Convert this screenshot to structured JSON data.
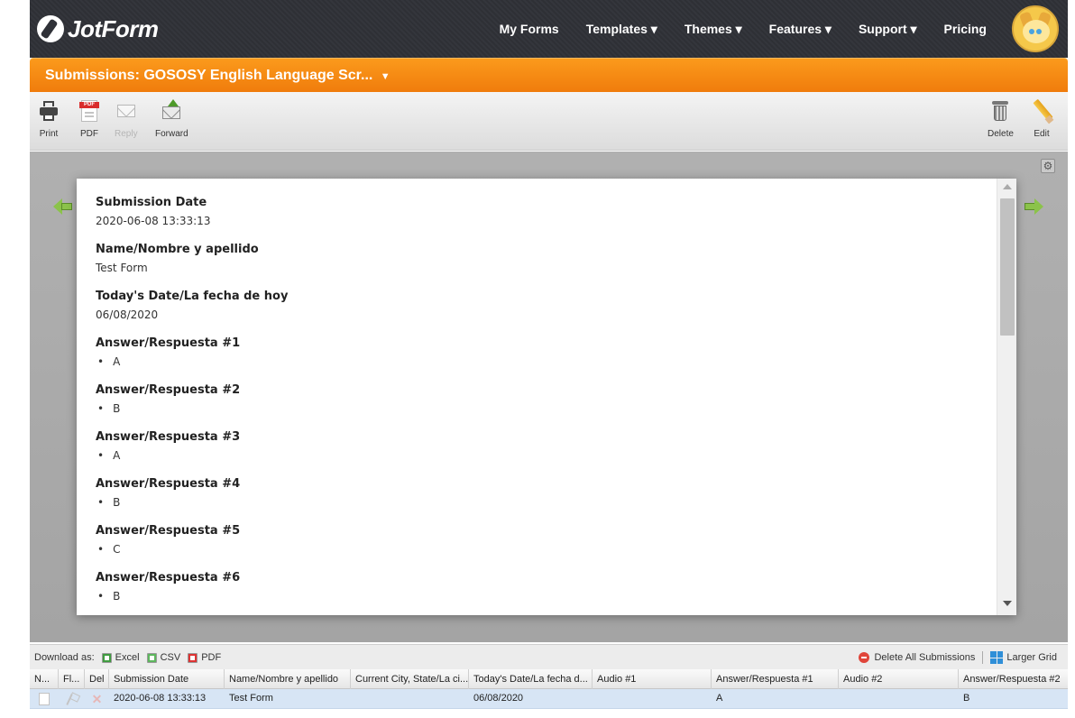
{
  "nav": {
    "logo": "JotForm",
    "items": [
      "My Forms",
      "Templates ▾",
      "Themes ▾",
      "Features ▾",
      "Support ▾",
      "Pricing"
    ]
  },
  "titlebar": {
    "title": "Submissions: GOSOSY English Language Scr...",
    "caret": "▼"
  },
  "toolbar": {
    "print": "Print",
    "pdf": "PDF",
    "pdf_badge": "PDF",
    "reply": "Reply",
    "forward": "Forward",
    "delete": "Delete",
    "edit": "Edit"
  },
  "submission": {
    "fields": [
      {
        "label": "Submission Date",
        "value": "2020-06-08 13:33:13",
        "bullet": false
      },
      {
        "label": "Name/Nombre y apellido",
        "value": "Test Form",
        "bullet": false
      },
      {
        "label": "Today's Date/La fecha de hoy",
        "value": "06/08/2020",
        "bullet": false
      },
      {
        "label": "Answer/Respuesta #1",
        "value": "A",
        "bullet": true
      },
      {
        "label": "Answer/Respuesta #2",
        "value": "B",
        "bullet": true
      },
      {
        "label": "Answer/Respuesta #3",
        "value": "A",
        "bullet": true
      },
      {
        "label": "Answer/Respuesta #4",
        "value": "B",
        "bullet": true
      },
      {
        "label": "Answer/Respuesta #5",
        "value": "C",
        "bullet": true
      },
      {
        "label": "Answer/Respuesta #6",
        "value": "B",
        "bullet": true
      }
    ]
  },
  "downloadbar": {
    "label": "Download as:",
    "excel": "Excel",
    "csv": "CSV",
    "pdf": "PDF",
    "delete_all": "Delete All Submissions",
    "larger_grid": "Larger Grid"
  },
  "grid": {
    "headers": [
      "N...",
      "Fl...",
      "Del",
      "Submission Date",
      "Name/Nombre y apellido",
      "Current City, State/La ci...",
      "Today's Date/La fecha d...",
      "Audio #1",
      "Answer/Respuesta #1",
      "Audio #2",
      "Answer/Respuesta #2"
    ],
    "row": {
      "submission_date": "2020-06-08 13:33:13",
      "name": "Test Form",
      "city": "",
      "date": "06/08/2020",
      "audio1": "",
      "answer1": "A",
      "audio2": "",
      "answer2": "B"
    }
  },
  "colors": {
    "nav_bg": "#2f3137",
    "title_orange": "#f58a14",
    "viewer_gray": "#aaaaaa",
    "row_selected": "#d7e5f5"
  },
  "icons": [
    "print-icon",
    "pdf-icon",
    "reply-icon",
    "forward-icon",
    "delete-icon",
    "edit-icon",
    "gear-icon",
    "prev-arrow-icon",
    "next-arrow-icon",
    "excel-icon",
    "csv-icon",
    "pdf-file-icon",
    "delete-all-icon",
    "larger-grid-icon"
  ]
}
